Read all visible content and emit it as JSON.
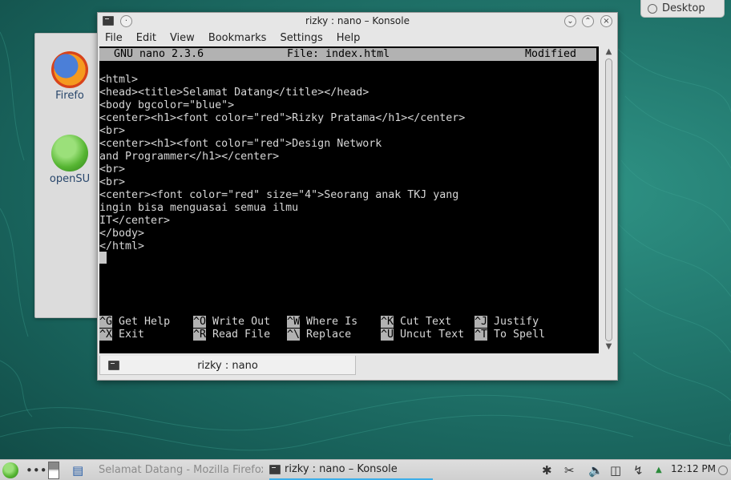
{
  "desktop": {
    "icons": [
      {
        "label": "Firefo"
      },
      {
        "label": "openSU"
      }
    ],
    "desktop_button": "Desktop"
  },
  "window": {
    "title": "rizky : nano – Konsole",
    "menu": [
      "File",
      "Edit",
      "View",
      "Bookmarks",
      "Settings",
      "Help"
    ],
    "tab_label": "rizky : nano"
  },
  "nano": {
    "version": "GNU nano 2.3.6",
    "file": "File: index.html",
    "state": "Modified",
    "lines": [
      "",
      "<html>",
      "<head><title>Selamat Datang</title></head>",
      "<body bgcolor=\"blue\">",
      "<center><h1><font color=\"red\">Rizky Pratama</h1></center>",
      "<br>",
      "<center><h1><font color=\"red\">Design Network",
      "and Programmer</h1></center>",
      "<br>",
      "<br>",
      "<center><font color=\"red\" size=\"4\">Seorang anak TKJ yang",
      "ingin bisa menguasai semua ilmu",
      "IT</center>",
      "</body>",
      "</html>"
    ],
    "shortcuts_row1": [
      {
        "key": "^G",
        "label": "Get Help"
      },
      {
        "key": "^O",
        "label": "Write Out"
      },
      {
        "key": "^W",
        "label": "Where Is"
      },
      {
        "key": "^K",
        "label": "Cut Text"
      },
      {
        "key": "^J",
        "label": "Justify"
      }
    ],
    "shortcuts_row2": [
      {
        "key": "^X",
        "label": "Exit"
      },
      {
        "key": "^R",
        "label": "Read File"
      },
      {
        "key": "^\\",
        "label": "Replace"
      },
      {
        "key": "^U",
        "label": "Uncut Text"
      },
      {
        "key": "^T",
        "label": "To Spell"
      }
    ]
  },
  "taskbar": {
    "tasks": [
      {
        "label": "Selamat Datang - Mozilla Firefox"
      },
      {
        "label": "rizky : nano – Konsole"
      }
    ],
    "clock": "12:12 PM"
  }
}
